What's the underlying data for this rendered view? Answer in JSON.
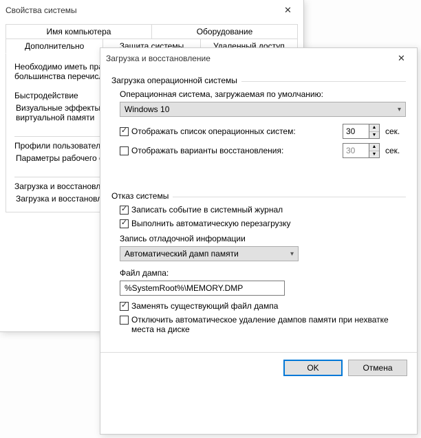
{
  "back_window": {
    "title": "Свойства системы",
    "tabs_row1": [
      "Имя компьютера",
      "Оборудование"
    ],
    "tabs_row2": [
      "Дополнительно",
      "Защита системы",
      "Удаленный доступ"
    ],
    "active_tab": "Дополнительно",
    "note": "Необходимо иметь права администратора для изменения большинства перечисленных параметров.",
    "s1_title": "Быстродействие",
    "s1_text": "Визуальные эффекты, использование процессора, оперативной и виртуальной памяти",
    "s2_title": "Профили пользователей",
    "s2_text": "Параметры рабочего стола, относящиеся ко входу в систему",
    "s3_title": "Загрузка и восстановление",
    "s3_text": "Загрузка и восстановление системы, отладочная информация"
  },
  "front_window": {
    "title": "Загрузка и восстановление",
    "boot": {
      "group_title": "Загрузка операционной системы",
      "default_os_label": "Операционная система, загружаемая по умолчанию:",
      "default_os_value": "Windows 10",
      "show_list_label": "Отображать список операционных систем:",
      "show_list_value": "30",
      "recovery_list_label": "Отображать варианты восстановления:",
      "recovery_list_value": "30",
      "sec_unit": "сек."
    },
    "fail": {
      "group_title": "Отказ системы",
      "log_label": "Записать событие в системный журнал",
      "reboot_label": "Выполнить автоматическую перезагрузку",
      "debug_title": "Запись отладочной информации",
      "debug_select": "Автоматический дамп памяти",
      "dump_file_label": "Файл дампа:",
      "dump_file_value": "%SystemRoot%\\MEMORY.DMP",
      "overwrite_label": "Заменять существующий файл дампа",
      "disable_autodel_label": "Отключить автоматическое удаление дампов памяти при нехватке места на диске"
    },
    "buttons": {
      "ok": "OK",
      "cancel": "Отмена"
    }
  }
}
